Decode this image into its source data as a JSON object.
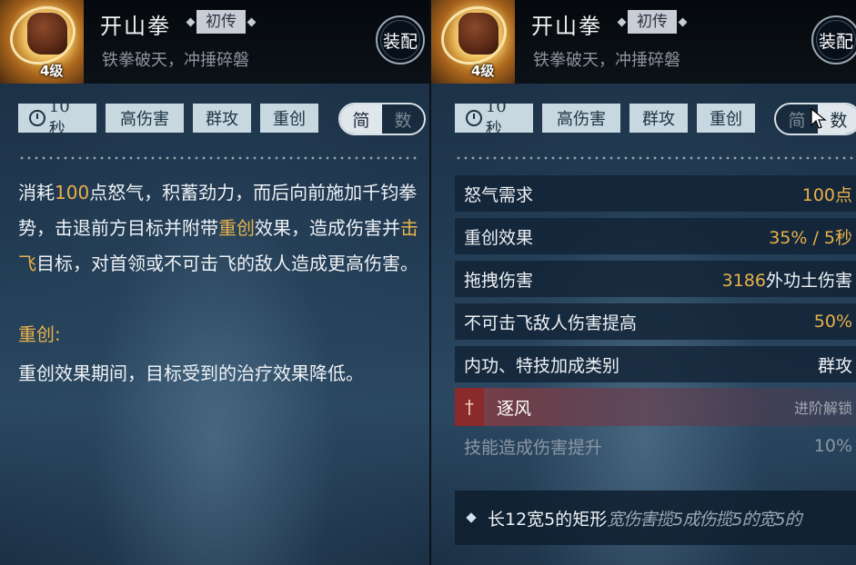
{
  "skill": {
    "name": "开山拳",
    "grade": "初传",
    "subtitle": "铁拳破天，冲捶碎磐",
    "level": "4级",
    "equip_label": "装配"
  },
  "tags": {
    "cooldown": "10秒",
    "items": [
      "高伤害",
      "群攻",
      "重创"
    ]
  },
  "toggle": {
    "simple": "简",
    "numeric": "数"
  },
  "left": {
    "desc_parts": [
      "消耗",
      "100",
      "点怒气，积蓄劲力，而后向前施加千钧拳势，击退前方目标并附带",
      "重创",
      "效果，造成伤害并",
      "击飞",
      "目标，对首领或不可击飞的敌人造成更高伤害。"
    ],
    "sub_heading": "重创:",
    "sub_desc": "重创效果期间，目标受到的治疗效果降低。"
  },
  "right": {
    "stats": [
      {
        "key": "怒气需求",
        "value": "100点"
      },
      {
        "key": "重创效果",
        "value": "35% / 5秒"
      },
      {
        "key": "拖拽伤害",
        "value": "3186",
        "suffix": "外功土伤害"
      },
      {
        "key": "不可击飞敌人伤害提高",
        "value": "50%"
      },
      {
        "key": "内功、特技加成类别",
        "value": "群攻"
      }
    ],
    "locked": {
      "name": "逐风",
      "unlock": "进阶解锁",
      "effect_key": "技能造成伤害提升",
      "effect_value": "10%"
    },
    "range": {
      "text": "长12宽5的矩形",
      "ghost": "宽伤害揽5成伤揽5的宽5的"
    }
  },
  "colors": {
    "accent": "#e8b14a",
    "tag_bg": "#c7d8e0",
    "locked_red": "#8b2a2a"
  }
}
